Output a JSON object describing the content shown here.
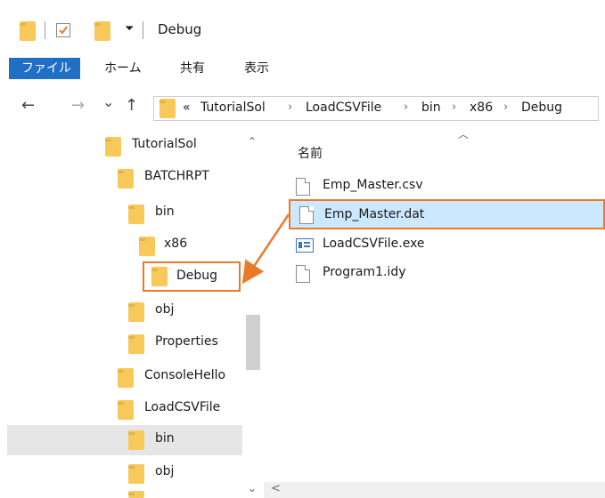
{
  "window": {
    "title": "Debug"
  },
  "ribbon": {
    "tabs": [
      "ファイル",
      "ホーム",
      "共有",
      "表示"
    ]
  },
  "nav": {
    "back": "←",
    "forward": "→",
    "recent": "⌄",
    "up": "↑"
  },
  "address": {
    "overflow": "«",
    "crumbs": [
      "TutorialSol",
      "LoadCSVFile",
      "bin",
      "x86",
      "Debug"
    ]
  },
  "tree": {
    "items": [
      {
        "label": "TutorialSol"
      },
      {
        "label": "BATCHRPT"
      },
      {
        "label": "bin"
      },
      {
        "label": "x86"
      },
      {
        "label": "Debug"
      },
      {
        "label": "obj"
      },
      {
        "label": "Properties"
      },
      {
        "label": "ConsoleHello"
      },
      {
        "label": "LoadCSVFile"
      },
      {
        "label": "bin"
      },
      {
        "label": "obj"
      }
    ]
  },
  "files": {
    "column_header": "名前",
    "items": [
      {
        "name": "Emp_Master.csv"
      },
      {
        "name": "Emp_Master.dat"
      },
      {
        "name": "LoadCSVFile.exe"
      },
      {
        "name": "Program1.idy"
      }
    ]
  },
  "colors": {
    "accent": "#1f6fc4",
    "highlight": "#ea7a2a",
    "selection": "#cce8ff"
  }
}
